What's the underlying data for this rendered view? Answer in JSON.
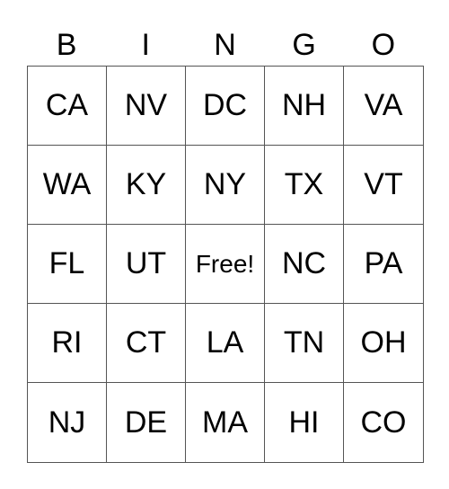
{
  "header": [
    "B",
    "I",
    "N",
    "G",
    "O"
  ],
  "rows": [
    [
      "CA",
      "NV",
      "DC",
      "NH",
      "VA"
    ],
    [
      "WA",
      "KY",
      "NY",
      "TX",
      "VT"
    ],
    [
      "FL",
      "UT",
      "Free!",
      "NC",
      "PA"
    ],
    [
      "RI",
      "CT",
      "LA",
      "TN",
      "OH"
    ],
    [
      "NJ",
      "DE",
      "MA",
      "HI",
      "CO"
    ]
  ]
}
